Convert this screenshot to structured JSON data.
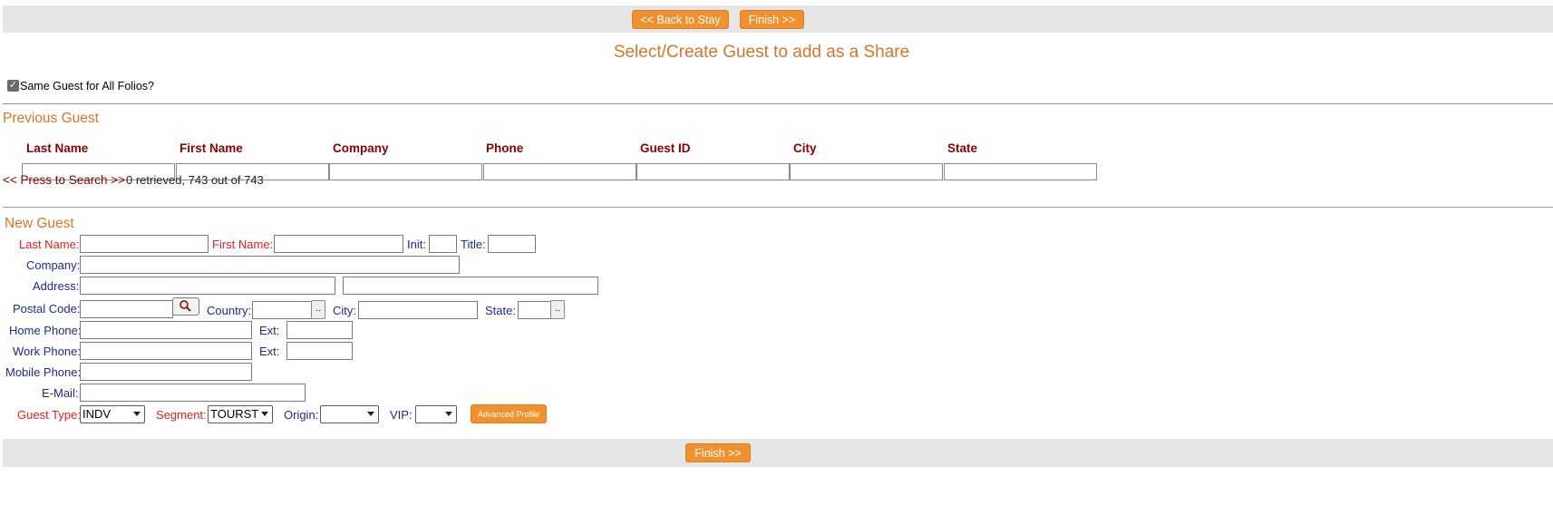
{
  "top_bar": {
    "back_label": "<< Back to Stay",
    "finish_label": "Finish >>"
  },
  "page_title": "Select/Create Guest to add as a Share",
  "same_guest": {
    "label": "Same Guest for All Folios?",
    "checked": true
  },
  "previous_guest": {
    "heading": "Previous Guest",
    "columns": [
      "Last Name",
      "First Name",
      "Company",
      "Phone",
      "Guest ID",
      "City",
      "State"
    ],
    "search_link": "<< Press to Search >>",
    "status": "0 retrieved, 743 out of 743"
  },
  "new_guest": {
    "heading": "New Guest",
    "labels": {
      "last_name": "Last Name:",
      "first_name": "First Name:",
      "init": "Init:",
      "title": "Title:",
      "company": "Company:",
      "address": "Address:",
      "postal_code": "Postal Code:",
      "country": "Country:",
      "city": "City:",
      "state": "State:",
      "home_phone": "Home Phone:",
      "ext": "Ext:",
      "work_phone": "Work Phone:",
      "mobile_phone": "Mobile Phone:",
      "email": "E-Mail:",
      "guest_type": "Guest Type:",
      "segment": "Segment:",
      "origin": "Origin:",
      "vip": "VIP:"
    },
    "guest_type_value": "INDV",
    "segment_value": "TOURST",
    "origin_value": "",
    "vip_value": "",
    "advanced_profile_label": "Advanced Profile",
    "lookup_button": "..",
    "search_icon": "magnifier-icon"
  },
  "bottom_bar": {
    "finish_label": "Finish >>"
  }
}
